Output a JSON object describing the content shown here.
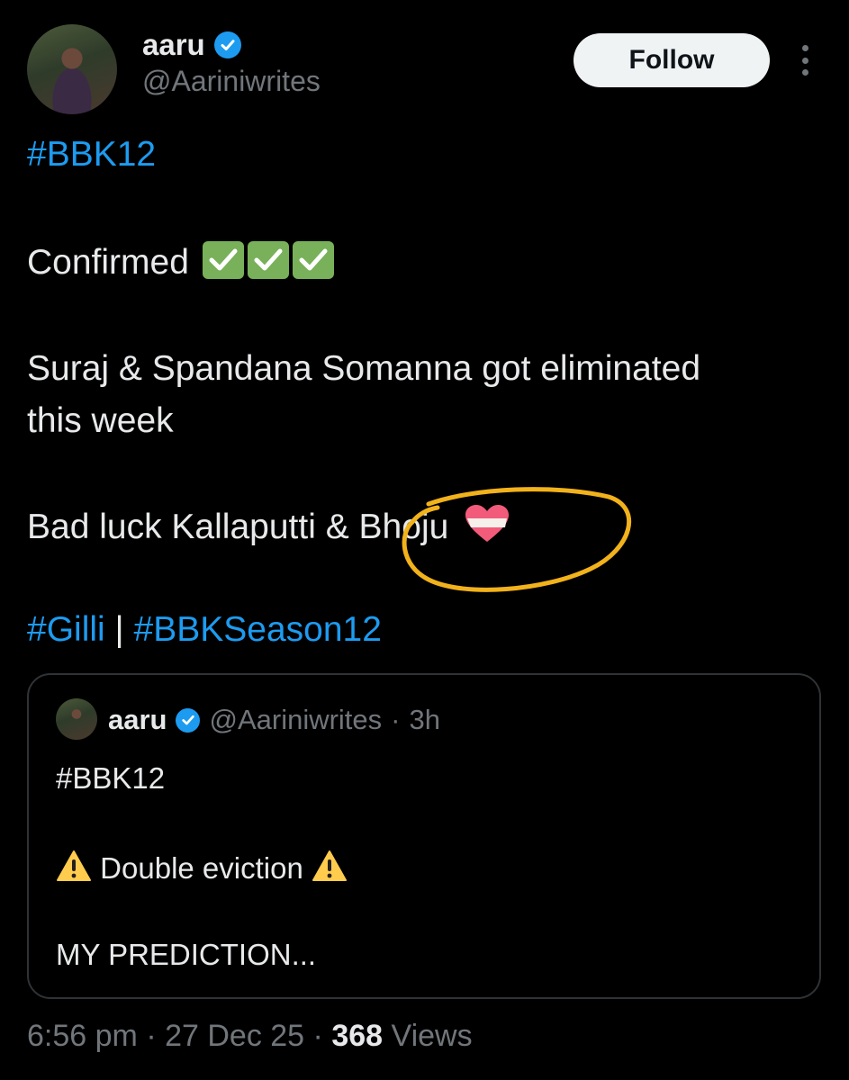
{
  "author": {
    "name": "aaru",
    "handle": "@Aariniwrites",
    "verified": true
  },
  "follow_button": {
    "label": "Follow"
  },
  "tweet": {
    "hashtag_top": "#BBK12",
    "confirmed": "Confirmed",
    "confirmed_emoji_count": 3,
    "line_eliminated_1": "Suraj & Spandana Somanna got eliminated",
    "line_eliminated_2": "this week",
    "bad_luck_prefix": "Bad luck Kallaputti &",
    "bad_luck_name": "Bhoju",
    "hashtag_gilli": "#Gilli",
    "separator": "|",
    "hashtag_season": "#BBKSeason12"
  },
  "quote": {
    "name": "aaru",
    "handle": "@Aariniwrites",
    "dot": "·",
    "time": "3h",
    "hashtag": "#BBK12",
    "eviction": "Double eviction",
    "prediction": "MY PREDICTION..."
  },
  "footer": {
    "time": "6:56 pm",
    "dot1": "·",
    "date": "27 Dec 25",
    "dot2": "·",
    "views_count": "368",
    "views_label": "Views"
  },
  "colors": {
    "accent": "#1d9bf0",
    "annotation_circle": "#f2b21b",
    "check_green": "#78b159",
    "muted": "#71767b"
  }
}
